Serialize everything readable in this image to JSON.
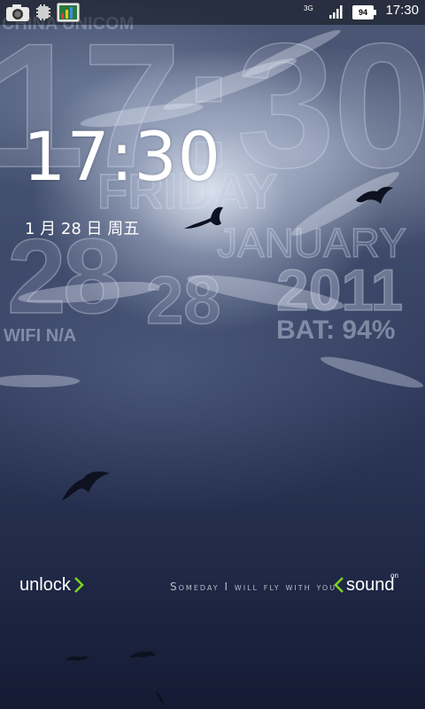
{
  "status_bar": {
    "network_type": "3G",
    "battery_level": "94",
    "time": "17:30",
    "icons": [
      "camera-icon",
      "usb-icon",
      "chart-icon",
      "signal-icon",
      "battery-icon"
    ]
  },
  "background_text": {
    "carrier": "CHINA UNICOM",
    "time": "17:30",
    "weekday": "FRIDAY",
    "month": "JANUARY",
    "day_big": "28",
    "day_small": "28",
    "year": "2011",
    "wifi": "WIFI N/A",
    "battery": "BAT: 94%"
  },
  "lock": {
    "time": "17:30",
    "date": "1 月 28 日 周五"
  },
  "controls": {
    "unlock_label": "unlock",
    "sound_label": "sound",
    "sound_state": "on",
    "tagline": "Someday I will fly with you"
  },
  "colors": {
    "accent_arrow": "#7ed321"
  }
}
